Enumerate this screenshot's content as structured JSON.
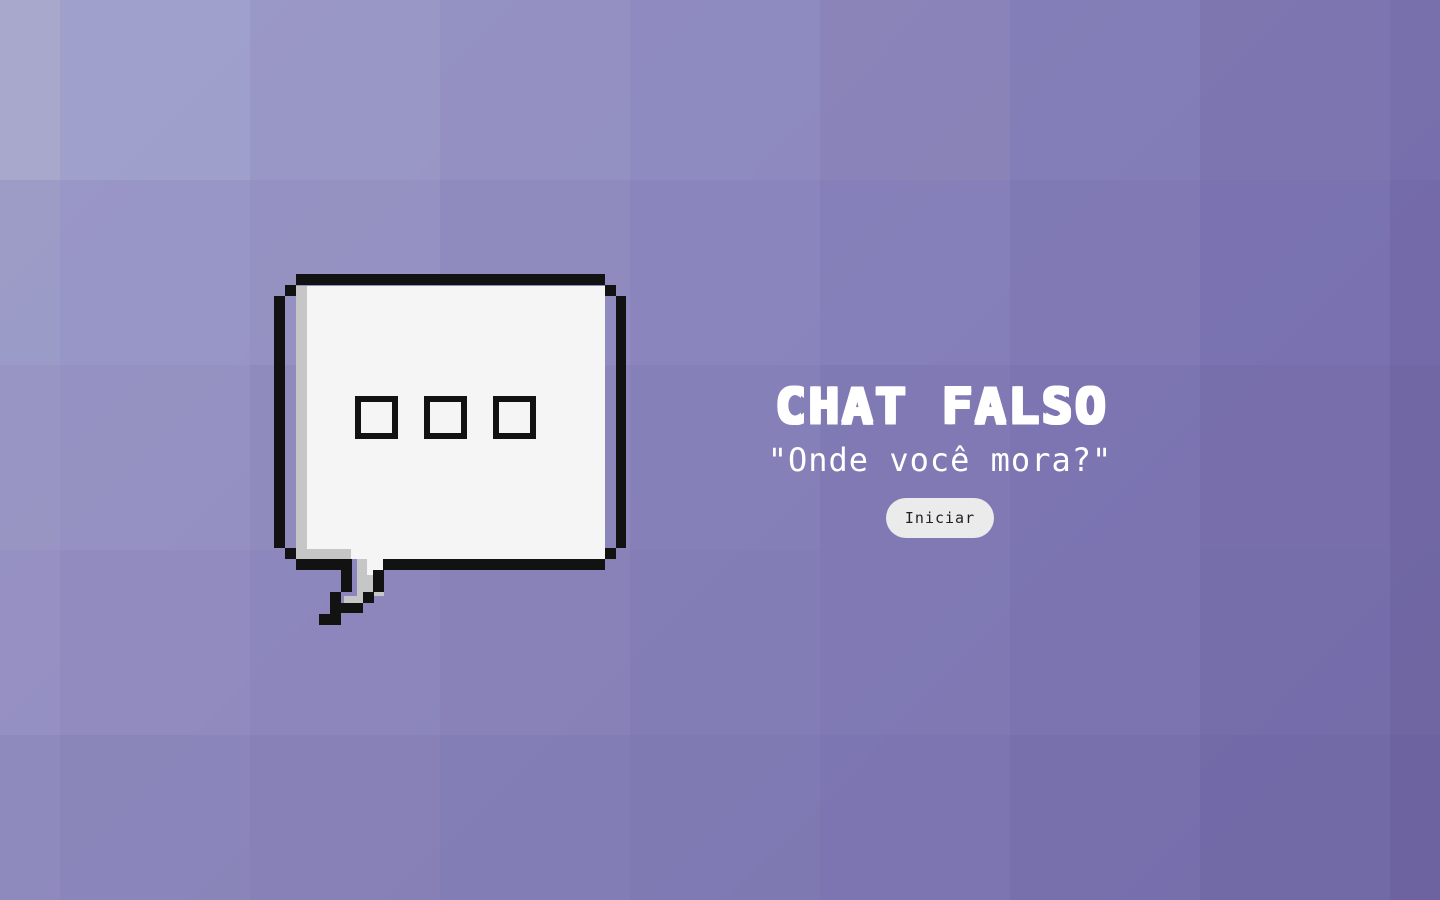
{
  "app": {
    "title": "CHAT FALSO",
    "subtitle": "\"Onde você mora?\"",
    "start_label": "Iniciar"
  },
  "colors": {
    "background_light": "#a6a7cc",
    "background_mid": "#8079b4",
    "background_dark": "#6f64a1",
    "bubble_fill": "#f5f5f5",
    "bubble_outline": "#121212",
    "bubble_shadow": "#c6c6c6",
    "button_bg": "#ebebeb",
    "text": "#ffffff"
  },
  "icons": {
    "chat_bubble": "pixel-speech-bubble-icon",
    "typing_dots": "ellipsis-icon"
  }
}
